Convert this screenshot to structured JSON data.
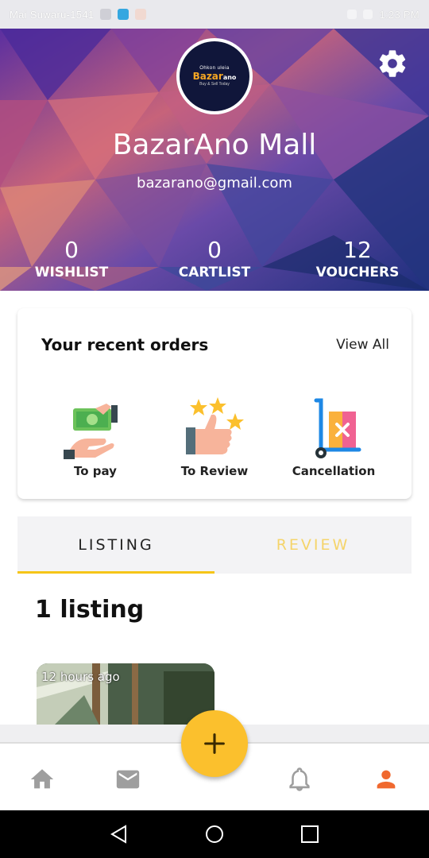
{
  "status_bar": {
    "left_text": "Mai Suwaru-1541",
    "right_text": "1:23 PM"
  },
  "profile": {
    "name": "BazarAno Mall",
    "email": "bazarano@gmail.com",
    "logo_top": "Ohkon uleia",
    "logo_main": "Bazar",
    "logo_main_suffix": "ano",
    "logo_sub": "Buy & Sell Today"
  },
  "stats": [
    {
      "value": "0",
      "label": "WISHLIST"
    },
    {
      "value": "0",
      "label": "CARTLIST"
    },
    {
      "value": "12",
      "label": "VOUCHERS"
    }
  ],
  "orders": {
    "title": "Your recent orders",
    "view_all": "View All",
    "items": [
      {
        "label": "To pay",
        "icon": "money-hand-icon"
      },
      {
        "label": "To Review",
        "icon": "thumbs-up-stars-icon"
      },
      {
        "label": "Cancellation",
        "icon": "trolley-cancel-icon"
      }
    ]
  },
  "tabs": [
    {
      "label": "LISTING",
      "active": true
    },
    {
      "label": "REVIEW",
      "active": false
    }
  ],
  "listing": {
    "count_text": "1 listing",
    "item_time": "12 hours ago"
  },
  "colors": {
    "accent": "#fbc02d",
    "tab_inactive": "#f5d46a",
    "profile_icon": "#f0692f",
    "nav_icon": "#9e9e9e"
  }
}
